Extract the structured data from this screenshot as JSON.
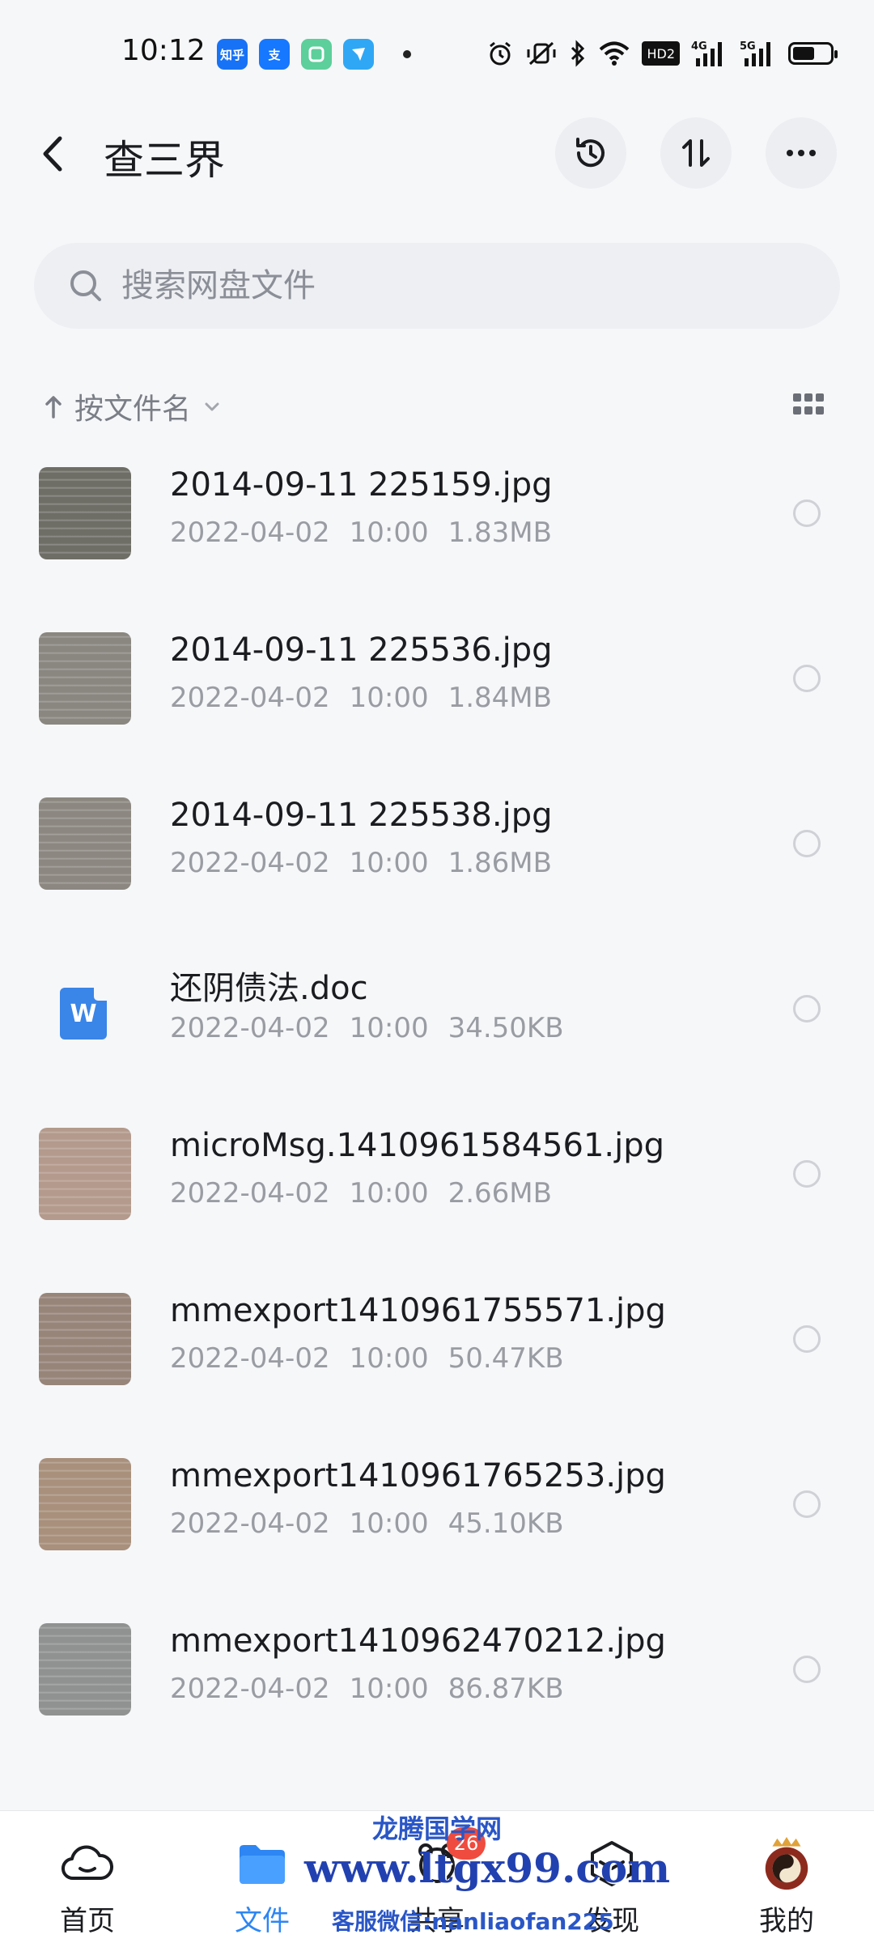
{
  "status_bar": {
    "time": "10:12",
    "apps": [
      {
        "icon": "zhihu-icon",
        "text": "知乎",
        "color": "#1772f6"
      },
      {
        "icon": "alipay-icon",
        "text": "支",
        "color": "#1677ff"
      },
      {
        "icon": "green-app-icon",
        "text": "",
        "color": "#5ccf9b"
      },
      {
        "icon": "dingtalk-icon",
        "text": "",
        "color": "#2fa7f5"
      }
    ],
    "network_labels": {
      "hd": "HD2",
      "n1": "4G",
      "n2": "5G"
    }
  },
  "header": {
    "title": "查三界"
  },
  "search": {
    "placeholder": "搜索网盘文件"
  },
  "sort": {
    "label": "按文件名"
  },
  "files": [
    {
      "name": "2014-09-11 225159.jpg",
      "date": "2022-04-02",
      "time": "10:00",
      "size": "1.83MB",
      "type": "image",
      "tone": "#6f6e66"
    },
    {
      "name": "2014-09-11 225536.jpg",
      "date": "2022-04-02",
      "time": "10:00",
      "size": "1.84MB",
      "type": "image",
      "tone": "#8a8680"
    },
    {
      "name": "2014-09-11 225538.jpg",
      "date": "2022-04-02",
      "time": "10:00",
      "size": "1.86MB",
      "type": "image",
      "tone": "#8c8780"
    },
    {
      "name": "还阴债法.doc",
      "date": "2022-04-02",
      "time": "10:00",
      "size": "34.50KB",
      "type": "doc",
      "doc_letter": "W"
    },
    {
      "name": "microMsg.1410961584561.jpg",
      "date": "2022-04-02",
      "time": "10:00",
      "size": "2.66MB",
      "type": "image",
      "tone": "#b39a8c"
    },
    {
      "name": "mmexport1410961755571.jpg",
      "date": "2022-04-02",
      "time": "10:00",
      "size": "50.47KB",
      "type": "image",
      "tone": "#97857a"
    },
    {
      "name": "mmexport1410961765253.jpg",
      "date": "2022-04-02",
      "time": "10:00",
      "size": "45.10KB",
      "type": "image",
      "tone": "#a8907c"
    },
    {
      "name": "mmexport1410962470212.jpg",
      "date": "2022-04-02",
      "time": "10:00",
      "size": "86.87KB",
      "type": "image",
      "tone": "#8f9290"
    }
  ],
  "bottom_nav": {
    "items": [
      {
        "label": "首页",
        "icon": "cloud-home-icon"
      },
      {
        "label": "文件",
        "icon": "folder-icon",
        "active": true
      },
      {
        "label": "共享",
        "icon": "share-icon",
        "badge": "26"
      },
      {
        "label": "发现",
        "icon": "discover-cube-icon"
      },
      {
        "label": "我的",
        "icon": "avatar"
      }
    ]
  },
  "watermark": {
    "line1": "龙腾国学网",
    "line2": "www.ltgx99.com",
    "line3": "客服微信:nanliaofan225"
  },
  "colors": {
    "accent": "#2d86f3",
    "badge": "#ef4b3e",
    "background": "#f6f7f9",
    "meta_text": "#9a9ca3"
  }
}
